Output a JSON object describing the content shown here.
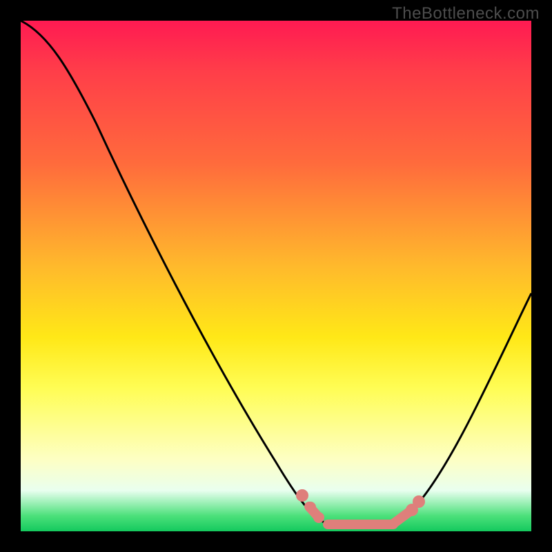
{
  "watermark": "TheBottleneck.com",
  "chart_data": {
    "type": "line",
    "title": "",
    "xlabel": "",
    "ylabel": "",
    "xlim": [
      0,
      100
    ],
    "ylim": [
      0,
      100
    ],
    "series": [
      {
        "name": "curve",
        "x": [
          0,
          6,
          16,
          26,
          36,
          46,
          53,
          57,
          60,
          66,
          72,
          78,
          84,
          90,
          96,
          100
        ],
        "y": [
          100,
          98,
          80,
          62,
          44,
          26,
          12,
          5,
          2,
          0,
          0,
          2,
          10,
          24,
          40,
          52
        ]
      }
    ],
    "highlight_flat": {
      "x": [
        55,
        58,
        61,
        64,
        67,
        70,
        73,
        75
      ],
      "y": [
        4,
        2,
        1,
        0,
        0,
        0,
        1,
        3
      ]
    },
    "gradient_bands": [
      {
        "pos": 0.0,
        "color": "#ff1a52",
        "meaning": "severe-bottleneck"
      },
      {
        "pos": 0.5,
        "color": "#ffd21a",
        "meaning": "moderate"
      },
      {
        "pos": 0.95,
        "color": "#fbffe0",
        "meaning": "near-ideal"
      },
      {
        "pos": 1.0,
        "color": "#14c95e",
        "meaning": "ideal"
      }
    ]
  }
}
